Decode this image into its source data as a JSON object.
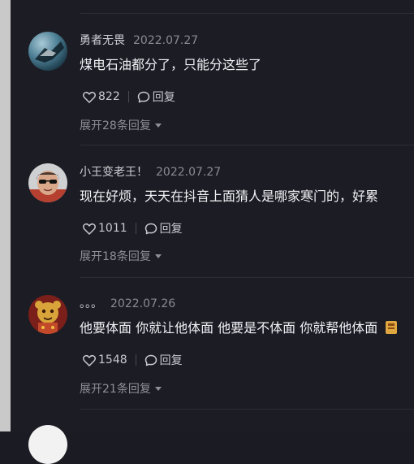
{
  "comments": [
    {
      "username": "勇者无畏",
      "date": "2022.07.27",
      "text": "煤电石油都分了，只能分这些了",
      "likes": "822",
      "reply_label": "回复",
      "expand_label": "展开28条回复"
    },
    {
      "username": "小王变老王！",
      "date": "2022.07.27",
      "text": "现在好烦，天天在抖音上面猜人是哪家寒门的，好累",
      "likes": "1011",
      "reply_label": "回复",
      "expand_label": "展开18条回复"
    },
    {
      "username": "。。。",
      "date": "2022.07.26",
      "text": "他要体面 你就让他体面 他要是不体面 你就帮他体面",
      "likes": "1548",
      "reply_label": "回复",
      "expand_label": "展开21条回复"
    }
  ]
}
